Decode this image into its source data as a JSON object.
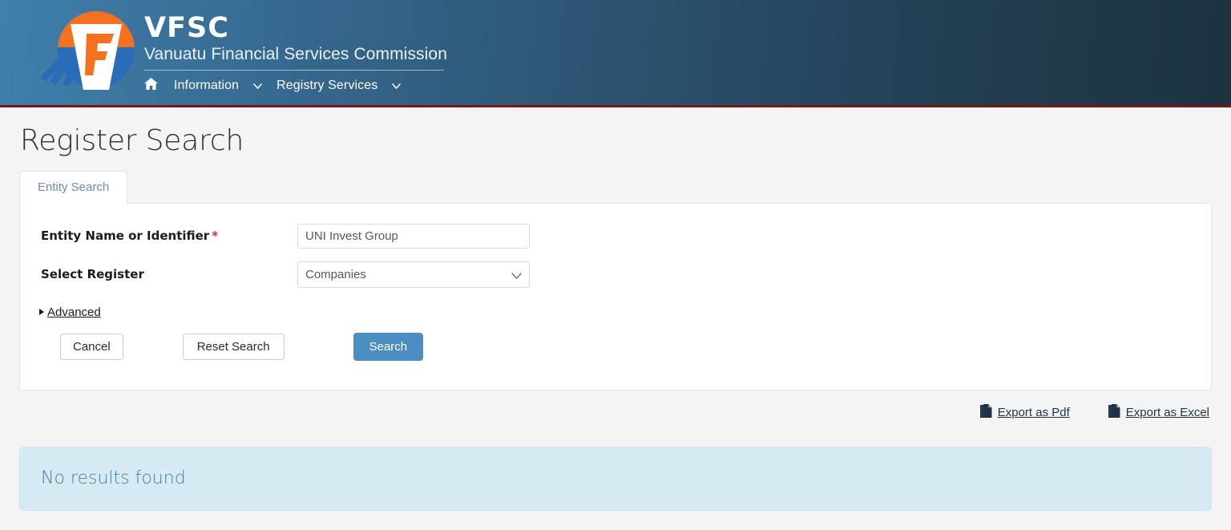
{
  "header": {
    "logo_icon": "vfsc-shield-logo",
    "brand_title": "VFSC",
    "brand_subtitle": "Vanuatu Financial Services Commission",
    "nav": {
      "home_icon": "home-icon",
      "items": [
        {
          "label": "Information",
          "caret_icon": "chevron-down-icon"
        },
        {
          "label": "Registry Services",
          "caret_icon": "chevron-down-icon"
        }
      ]
    },
    "colors": {
      "gradient_from": "#3f80ad",
      "gradient_to": "#1c3341",
      "bottom_border": "#7b1616",
      "logo_orange": "#f3711f",
      "logo_blue": "#2a6cb8"
    }
  },
  "page": {
    "title": "Register Search",
    "background": "#f4f4f4"
  },
  "tabs": [
    {
      "label": "Entity Search",
      "active": true
    }
  ],
  "search_form": {
    "entity_name": {
      "label": "Entity Name or Identifier",
      "required_marker": "*",
      "value": "UNI Invest Group",
      "placeholder": ""
    },
    "select_register": {
      "label": "Select Register",
      "value": "Companies",
      "caret_icon": "chevron-down-icon",
      "options": [
        "Companies"
      ]
    },
    "advanced": {
      "label": "Advanced",
      "toggle_icon": "triangle-right-icon",
      "expanded": false
    },
    "buttons": {
      "cancel": "Cancel",
      "reset": "Reset Search",
      "search": "Search",
      "search_color": "#4a8ec2"
    }
  },
  "export": [
    {
      "label": "Export as Pdf",
      "icon": "file-document-icon"
    },
    {
      "label": "Export as Excel",
      "icon": "file-document-icon"
    }
  ],
  "results": {
    "message": "No results found",
    "background": "#d6eaf3",
    "text_color": "#4f7f97"
  }
}
